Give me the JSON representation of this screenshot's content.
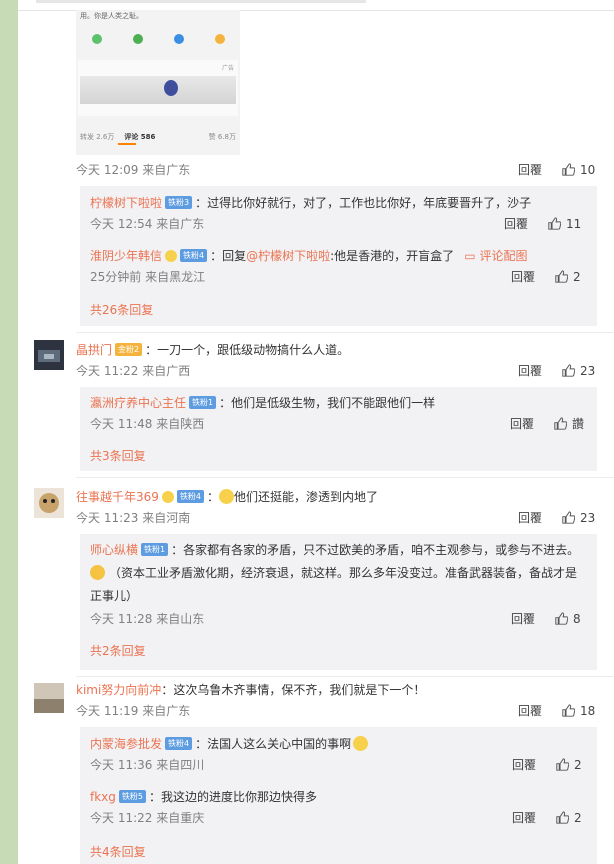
{
  "embedded": {
    "text_line2": "用。你是人类之耻。",
    "ad_label": "广告",
    "tab_repost": "转发 2.6万",
    "tab_comment": "评论 586",
    "tab_like": "赞 6.8万"
  },
  "threads": [
    {
      "time": "今天 12:09 来自广东",
      "reply": "回覆",
      "likes": "10",
      "replies": [
        {
          "name": "柠檬树下啦啦",
          "badge": "铁粉3",
          "text": "：过得比你好就行，对了，工作也比你好，年底要晋升了，沙子",
          "time": "今天 12:54 来自广东",
          "reply": "回覆",
          "likes": "11"
        },
        {
          "name": "淮阴少年韩信",
          "badge": "铁粉4",
          "text": "：回复",
          "mention": "@柠檬树下啦啦",
          "text2": ":他是香港的，开盲盒了",
          "link": "评论配图",
          "time": "25分钟前 来自黑龙江",
          "reply": "回覆",
          "likes": "2"
        }
      ],
      "more": "共26条回复"
    },
    {
      "name": "晶拱门",
      "badge": "金粉2",
      "text": "：一刀一个，跟低级动物搞什么人道。",
      "time": "今天 11:22 来自广西",
      "reply": "回覆",
      "likes": "23",
      "replies": [
        {
          "name": "瀛洲疗养中心主任",
          "badge": "铁粉1",
          "text": "：他们是低级生物，我们不能跟他们一样",
          "time": "今天 11:48 来自陕西",
          "reply": "回覆",
          "likes": "讚"
        }
      ],
      "more": "共3条回复"
    },
    {
      "name": "往事越千年369",
      "badge": "铁粉4",
      "text": "：",
      "text2": "他们还挺能，渗透到内地了",
      "time": "今天 11:23 来自河南",
      "reply": "回覆",
      "likes": "23",
      "replies": [
        {
          "name": "师心纵横",
          "badge": "铁粉1",
          "text": "：各家都有各家的矛盾，只不过欧美的矛盾，咱不主观参与，或参与不进去。",
          "text_line2": "（资本工业矛盾激化期，经济衰退，就这样。那么多年没变过。准备武器装备，备战才是",
          "text_line3": "正事儿）",
          "time": "今天 11:28 来自山东",
          "reply": "回覆",
          "likes": "8"
        }
      ],
      "more": "共2条回复"
    },
    {
      "name": "kimi努力向前冲",
      "text": "：这次乌鲁木齐事情，保不齐，我们就是下一个！",
      "time": "今天 11:19 来自广东",
      "reply": "回覆",
      "likes": "18",
      "replies": [
        {
          "name": "内蒙海参批发",
          "badge": "铁粉4",
          "text": "：法国人这么关心中国的事啊",
          "time": "今天 11:36 来自四川",
          "reply": "回覆",
          "likes": "2"
        },
        {
          "name": "fkxg",
          "badge": "铁粉5",
          "text": "：我这边的进度比你那边快得多",
          "time": "今天 11:22 来自重庆",
          "reply": "回覆",
          "likes": "2"
        }
      ],
      "more": "共4条回复"
    }
  ],
  "icons": {
    "like": "thumb-up-icon",
    "image": "image-icon",
    "emoji": "emoji-icon"
  },
  "colors": {
    "username": "#eb7350",
    "meta": "#808080",
    "subbg": "#f2f2f5",
    "accent": "#ff8200"
  }
}
